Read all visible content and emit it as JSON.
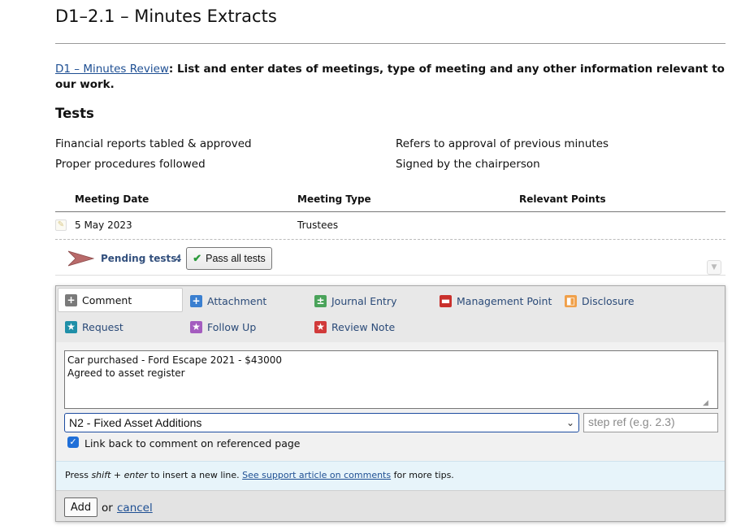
{
  "page": {
    "title": "D1–2.1 – Minutes Extracts",
    "intro_link": "D1 – Minutes Review",
    "intro_colon": ":",
    "intro_text": "List and enter dates of meetings, type of meeting and any other information relevant to our work."
  },
  "tests": {
    "heading": "Tests",
    "items": [
      "Financial reports tabled & approved",
      "Refers to approval of previous minutes",
      "Proper procedures followed",
      "Signed by the chairperson"
    ]
  },
  "table": {
    "columns": [
      "Meeting Date",
      "Meeting Type",
      "Relevant Points"
    ],
    "rows": [
      {
        "date": "5 May 2023",
        "type": "Trustees",
        "points": ""
      }
    ]
  },
  "pending": {
    "label": "Pending tests:",
    "count": "4",
    "pass_all_label": "Pass all tests"
  },
  "comment_panel": {
    "types": [
      {
        "label": "Comment",
        "icon": "plus-icon",
        "color": "#7a7a7a",
        "selected": true
      },
      {
        "label": "Attachment",
        "icon": "plus-icon",
        "color": "#3a7fd0"
      },
      {
        "label": "Journal Entry",
        "icon": "plus-minus-icon",
        "color": "#4aa35a"
      },
      {
        "label": "Management Point",
        "icon": "management-icon",
        "color": "#c9302c"
      },
      {
        "label": "Disclosure",
        "icon": "disclosure-icon",
        "color": "#f0a04a"
      },
      {
        "label": "Request",
        "icon": "star-icon",
        "color": "#1f8fa8"
      },
      {
        "label": "Follow Up",
        "icon": "star-icon",
        "color": "#a45cbf"
      },
      {
        "label": "Review Note",
        "icon": "star-icon",
        "color": "#d13a3a"
      }
    ],
    "comment_text": "Car purchased - Ford Escape 2021 - $43000\nAgreed to asset register",
    "reference_selected": "N2 - Fixed Asset Additions",
    "step_ref_placeholder": "step ref (e.g. 2.3)",
    "link_back_checked": true,
    "link_back_label": "Link back to comment on referenced page",
    "tip_prefix": "Press ",
    "tip_keys": "shift + enter",
    "tip_middle": " to insert a new line. ",
    "tip_link": "See support article on comments",
    "tip_suffix": " for more tips.",
    "add_label": "Add",
    "or_text": "or",
    "cancel_label": "cancel"
  }
}
